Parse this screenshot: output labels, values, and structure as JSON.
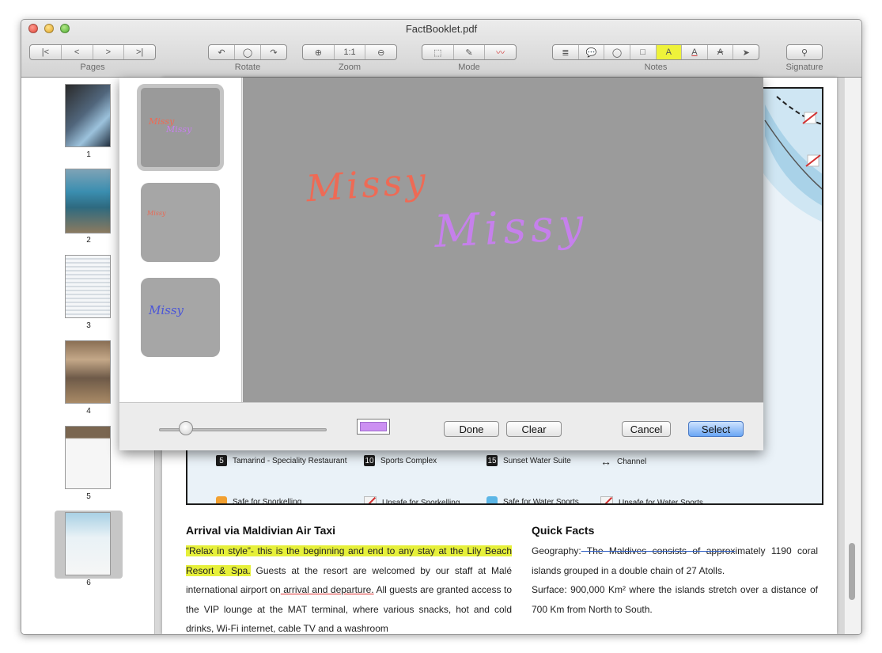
{
  "window": {
    "title": "FactBooklet.pdf"
  },
  "toolbar": {
    "groups": [
      {
        "label": "Pages",
        "segments": [
          "|<",
          "<",
          ">",
          ">|"
        ]
      },
      {
        "label": "Rotate",
        "segments": [
          "↶",
          "◯",
          "↷"
        ]
      },
      {
        "label": "Zoom",
        "segments": [
          "⊕",
          "1:1",
          "⊖"
        ]
      },
      {
        "label": "Mode",
        "segments": [
          "⬚",
          "✎",
          "〰"
        ]
      },
      {
        "label": "Notes",
        "segments": [
          "≣",
          "💬",
          "◯",
          "□",
          "A",
          "A",
          "A",
          "➤"
        ]
      },
      {
        "label": "Signature",
        "segments": [
          "⚲"
        ]
      }
    ]
  },
  "sidebar": {
    "thumbnails": [
      {
        "number": "1"
      },
      {
        "number": "2"
      },
      {
        "number": "3"
      },
      {
        "number": "4"
      },
      {
        "number": "5"
      },
      {
        "number": "6"
      }
    ],
    "selected_page": "6"
  },
  "map": {
    "legend": [
      {
        "badge": "5",
        "text": "Tamarind - Speciality Restaurant"
      },
      {
        "badge": "10",
        "text": "Sports Complex"
      },
      {
        "badge": "15",
        "text": "Sunset Water Suite"
      },
      {
        "badge": "↔",
        "text": "Channel"
      },
      {
        "badge": "",
        "text": "Safe for Snorkelling"
      },
      {
        "badge": "",
        "text": "Unsafe for Snorkelling"
      },
      {
        "badge": "",
        "text": "Safe for Water Sports"
      },
      {
        "badge": "",
        "text": "Unsafe for Water Sports"
      }
    ]
  },
  "article_left": {
    "title": "Arrival via Maldivian Air Taxi",
    "highlighted": "“Relax in style”- this is the beginning and end to any stay at the Lily Beach Resort & Spa.",
    "text1": " Guests at the resort are welcomed by our staff at Malé international airport on",
    "underlined": " arrival and departure.",
    "text2": " All guests are granted access to the VIP lounge at the MAT terminal, where various snacks, hot and cold drinks, Wi-Fi internet, cable TV and a washroom"
  },
  "article_right": {
    "title": "Quick Facts",
    "geo_label": "Geography:",
    "geo_strike": " The Maldives consists of approx",
    "geo_rest": "imately 1190 coral islands grouped in a double chain of 27 Atolls.",
    "surface": "Surface: 900,000 Km² where the islands stretch over a distance of 700 Km from North to South."
  },
  "signature_sheet": {
    "signatures": [
      {
        "text": "Missy",
        "colors": [
          "#ee6a55",
          "#c680ec"
        ]
      },
      {
        "text": "Missy",
        "colors": [
          "#e86a55"
        ]
      },
      {
        "text": "Missy",
        "colors": [
          "#4a55d8"
        ]
      }
    ],
    "canvas_signatures": [
      {
        "text": "Missy",
        "color": "#ee6a55"
      },
      {
        "text": "Missy",
        "color": "#c680ec"
      }
    ],
    "ink_color": "#cc90f2",
    "buttons": {
      "done": "Done",
      "clear": "Clear",
      "cancel": "Cancel",
      "select": "Select"
    }
  }
}
